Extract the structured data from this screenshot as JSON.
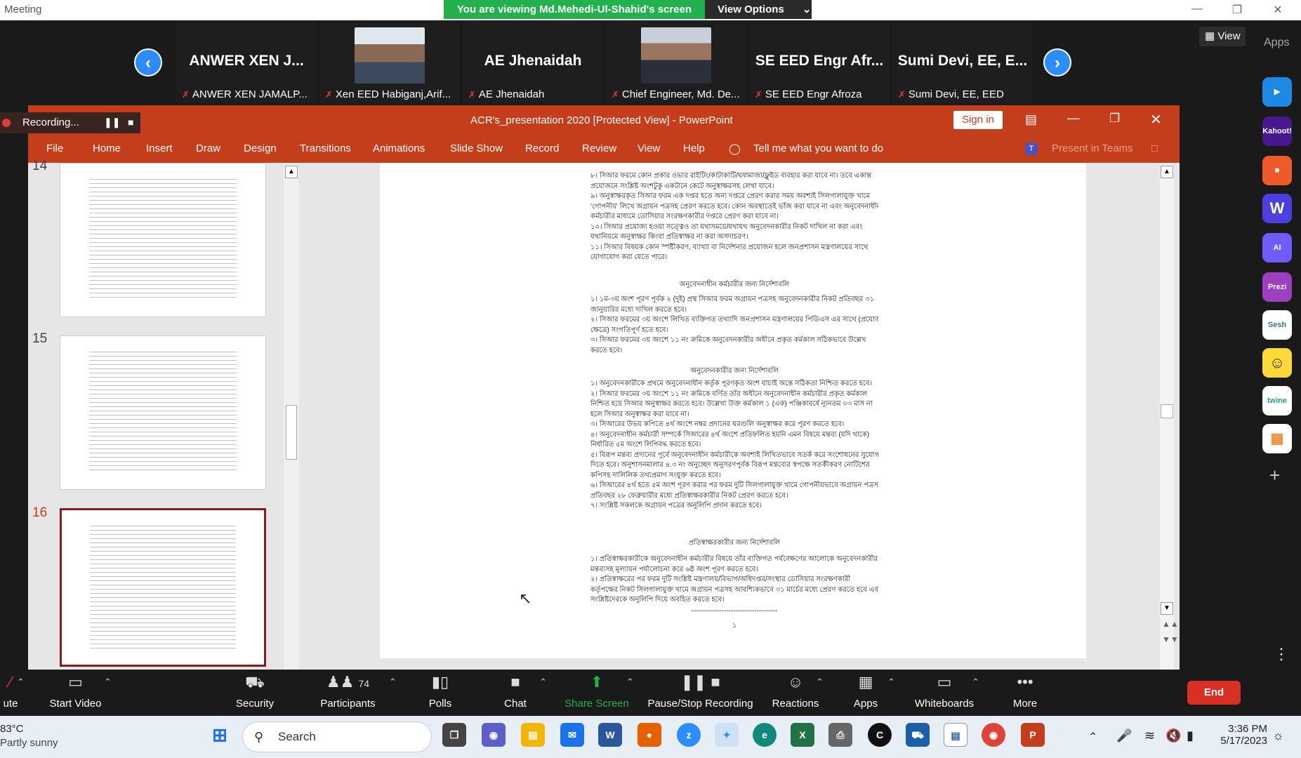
{
  "window": {
    "title": "Meeting"
  },
  "banner": {
    "viewing": "You are viewing Md.Mehedi-Ul-Shahid's screen",
    "view_options": "View Options"
  },
  "participants": [
    {
      "name": "ANWER XEN J...",
      "sub": "ANWER XEN JAMALP..."
    },
    {
      "name": "",
      "sub": "Xen EED Habiganj,Arif..."
    },
    {
      "name": "AE Jhenaidah",
      "sub": "AE Jhenaidah"
    },
    {
      "name": "",
      "sub": "Chief Engineer, Md. De..."
    },
    {
      "name": "SE EED Engr Afr...",
      "sub": "SE EED Engr Afroza"
    },
    {
      "name": "Sumi Devi, EE, E...",
      "sub": "Sumi Devi, EE, EED"
    }
  ],
  "view_button": "View",
  "apps_label": "Apps",
  "apps": [
    {
      "name": "Kahoot!",
      "color": "#46178f"
    },
    {
      "name": "Prezi",
      "color": "#9e3fbf"
    },
    {
      "name": "Sesh",
      "color": "#ffffff"
    },
    {
      "name": "twine",
      "color": "#ffffff"
    }
  ],
  "recording": {
    "label": "Recording..."
  },
  "powerpoint": {
    "title": "ACR's_presentation 2020 [Protected View]  -  PowerPoint",
    "sign_in": "Sign in",
    "tabs": [
      "File",
      "Home",
      "Insert",
      "Draw",
      "Design",
      "Transitions",
      "Animations",
      "Slide Show",
      "Record",
      "Review",
      "View",
      "Help"
    ],
    "tell_me": "Tell me what you want to do",
    "present_in_teams": "Present in Teams",
    "slide_numbers": [
      "14",
      "15",
      "16"
    ]
  },
  "slide": {
    "heading1": "অনুবেদনাধীন কর্মচারীর জন্য নির্দেশাবলি",
    "heading2": "অনুবেদনকারীর জন্য নির্দেশাবলি",
    "heading3": "প্রতিস্বাক্ষরকারীর জন্য নির্দেশাবলি",
    "block1": [
      "৮। সিআর ফরমে কোন প্রকার ওভার রাইটিং/কাটাকাটি/ঘষামাজা/ফ্লুইড ব্যবহার করা যাবে না। তবে একান্ত",
      "প্রয়োজনে সংশ্লিষ্ট অংশটুকু একটানে কেটে অনুস্বাক্ষরসহ লেখা যাবে।",
      "৯। অনুস্বাক্ষরকৃত সিআর ফরম এক দপ্তর হতে অন্য দপ্তরে প্রেরণ করার সময় অবশ্যই সিলগালাযুক্ত খামে",
      "'গোপনীয়' লিখে অগ্রায়ন পত্রসহ প্রেরণ করতে হবে। কোন অবস্থাতেই ভাঁজ করা যাবে না এবং অনুবেদনাধীন",
      "কর্মচারীর মাধ্যমে ডোসিয়ার সংরক্ষণকারীর দপ্তরে প্রেরণ করা যাবে না।",
      "১০। সিআর প্রযোজ্য হওয়া সত্ত্বেও তা যথাসময়ে/যথাযথ অনুবেদনকারীর নিকট দাখিল না করা এবং",
      "যথানিয়মে অনুস্বাক্ষর কিংবা প্রতিস্বাক্ষর না করা অসদাচরণ।",
      "১১। সিআর বিষয়ক কোন স্পষ্টীকরণ, ব্যাখ্যা বা নির্দেশনার প্রয়োজন হলে জনপ্রশাসন মন্ত্রণালয়ের সাথে",
      "যোগাযোগ করা যেতে পারে।"
    ],
    "block2": [
      "১। ১ম-৩য় অংশ পূরণ পূর্বক ২ (দুই) প্রস্থ সিআর ফরম অগ্রায়ন পত্রসহ অনুবেদনকারীর নিকট প্রতিবছর ৩১",
      "জানুয়ারির মধ্যে দাখিল করতে হবে।",
      "২। সিআর ফরমের ৩য় অংশে লিখিত ব্যক্তিগত তথ্যাদি জনপ্রশাসন মন্ত্রণালয়ের পিডিএস এর সাথে (প্রযোজ্য",
      "ক্ষেত্রে) সংগতিপূর্ণ হতে হবে।",
      "৩। সিআর ফরমের ৩য় অংশে ১১ নং ক্রমিকে অনুবেদনকারীর অধীনে প্রকৃত কর্মকাল সঠিকভাবে উল্লেখ",
      "করতে হবে।"
    ],
    "block3": [
      "১। অনুবেদনকারীকে প্রথমে অনুবেদনাধীন কর্তৃক পূরণকৃত অংশ যাচাই অন্তে সঠিকতা নিশ্চিত করতে হবে।",
      "২। সিআর ফরমের ৩য় অংশে ১১ নং ক্রমিকে বর্ণিত তাঁর অধীনে অনুবেদনাধীন কর্মচারীর প্রকৃত কর্মকাল",
      "নিশ্চিত হয়ে সিআর অনুস্বাক্ষর করতে হবে। উল্লেখ্য উক্ত কর্মকাল ১ (এক) পঞ্জিকাবর্ষে ন্যূনতম ০৩ মাস না",
      "হলে সিআর অনুস্বাক্ষর করা যাবে না।",
      "৩। সিআরের উভয় কপিতে ৪র্থ অংশে নম্বর প্রদানের ঘরগুলি অনুস্বাক্ষর করে পূরণ করতে হবে।",
      "৪। অনুবেদনাধীন কর্মচারী সম্পর্কে সিআরের ৪র্থ অংশে প্রতিফলিত হয়নি এমন বিষয়ে মন্তব্য (যদি থাকে)",
      "নির্ধারিত ৫ম অংশে লিপিবদ্ধ করতে হবে।",
      "৫। বিরূপ মন্তব্য প্রদানের পূর্বে অনুবেদনাধীন কর্মচারীকে অবশ্যই লিখিতভাবে সতর্ক করে সংশোধনের সুযোগ",
      "দিতে হবে। অনুশাসনমালার ৪.৩ নং অনুচ্ছেদ অনুসরণপূর্বক বিরূপ মন্তব্যের স্বপক্ষে সতর্কীকরণ নোটিশের",
      "কপিসহ দালিলিক তথ্যপ্রমাণ সংযুক্ত করতে হবে।",
      "৬। সিআরের ৪র্থ হতে ৫ম অংশ পূরণ করার পর ফরম দুটি সিলগালাযুক্ত খামে গোপনীয়ভাবে অগ্রায়ন পত্রসহ",
      "প্রতিবছর ২৮ ফেব্রুয়ারীর মধ্যে প্রতিস্বাক্ষরকারীর নিকট প্রেরণ করতে হবে।",
      "৭। সংশ্লিষ্ট সকলকে অগ্রায়ন পত্রের অনুলিপি প্রদান করতে হবে।"
    ],
    "block4": [
      "১। প্রতিস্বাক্ষরকারীকে অনুবেদনাধীন কর্মচারীর বিষয়ে তাঁর ব্যক্তিগত পর্যবেক্ষণের আলোকে অনুবেদনকারীর",
      "মন্তব্যসহ মূল্যায়ন পর্যালোচনা করে ৬ষ্ঠ অংশ পূরণ করতে হবে।",
      "২। প্রতিস্বাক্ষরের পর ফরম দুটি সংশ্লিষ্ট মন্ত্রণালয়/বিভাগ/অধিদপ্তর/সংস্থার ডোসিয়ার সংরক্ষণকারী",
      "কর্তৃপক্ষের নিকট সিলগালাযুক্ত খামে অগ্রায়ন পত্রসহ আবশ্যিকভাবে ৩১ মার্চের মধ্যে প্রেরণ করতে হবে এবং",
      "সংশ্লিষ্টদেরকে অনুলিপি দিয়ে অবহিত করতে হবে।"
    ],
    "rule": "-------------------------------------",
    "page_no": "১"
  },
  "toolbar": {
    "mute": "ute",
    "start_video": "Start Video",
    "security": "Security",
    "participants": "Participants",
    "participants_count": "74",
    "polls": "Polls",
    "chat": "Chat",
    "share_screen": "Share Screen",
    "pause_recording": "Pause/Stop Recording",
    "reactions": "Reactions",
    "apps": "Apps",
    "whiteboards": "Whiteboards",
    "more": "More",
    "end": "End"
  },
  "taskbar": {
    "temp": "83°C",
    "weather": "Partly sunny",
    "search": "Search",
    "time": "3:36 PM",
    "date": "5/17/2023"
  }
}
